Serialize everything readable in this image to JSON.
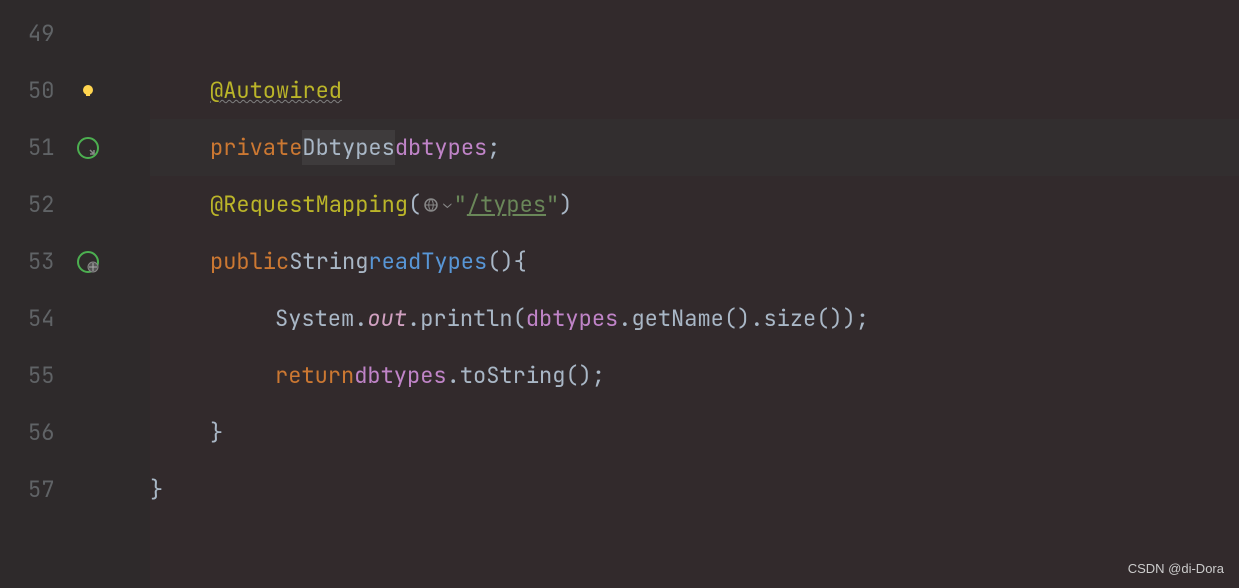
{
  "gutter": {
    "lines": [
      "49",
      "50",
      "51",
      "52",
      "53",
      "54",
      "55",
      "56",
      "57"
    ]
  },
  "code": {
    "line50": {
      "annotation": "@Autowired"
    },
    "line51": {
      "keyword": "private",
      "type": "Dbtypes",
      "field": "dbtypes",
      "semi": ";"
    },
    "line52": {
      "annotation": "@RequestMapping",
      "paren_open": "(",
      "string_open": "\"",
      "string_path": "/types",
      "string_close": "\"",
      "paren_close": ")"
    },
    "line53": {
      "keyword": "public",
      "returntype": "String",
      "method": "readTypes",
      "parens": "()",
      "brace": "{"
    },
    "line54": {
      "sysclass": "System",
      "dot1": ".",
      "out": "out",
      "dot2": ".",
      "println": "println",
      "open": "(",
      "field": "dbtypes",
      "dot3": ".",
      "getname": "getName",
      "call1": "()",
      "dot4": ".",
      "size": "size",
      "call2": "()",
      "close": ")",
      "semi": ";"
    },
    "line55": {
      "keyword": "return",
      "field": "dbtypes",
      "dot": ".",
      "tostring": "toString",
      "call": "()",
      "semi": ";"
    },
    "line56": {
      "brace": "}"
    },
    "line57": {
      "brace": "}"
    }
  },
  "watermark": "CSDN @di-Dora"
}
